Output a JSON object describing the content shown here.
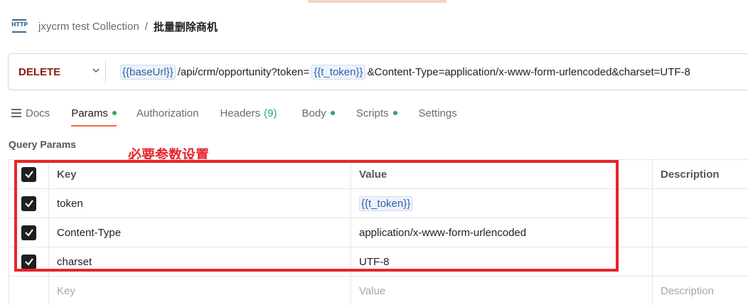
{
  "breadcrumb": {
    "icon": "http-request-icon",
    "parent": "jxycrm test Collection",
    "separator": "/",
    "current": "批量删除商机"
  },
  "request": {
    "method": "DELETE",
    "url_parts": {
      "base_var": "{{baseUrl}}",
      "path": "/api/crm/opportunity?token=",
      "token_var": "{{t_token}}",
      "query_tail": "&Content-Type=application/x-www-form-urlencoded&charset=UTF-8"
    }
  },
  "tabs": [
    {
      "label": "Docs",
      "icon": "docs-icon"
    },
    {
      "label": "Params",
      "active": true,
      "dot": true
    },
    {
      "label": "Authorization"
    },
    {
      "label": "Headers",
      "count": "(9)"
    },
    {
      "label": "Body",
      "dot": true
    },
    {
      "label": "Scripts",
      "dot": true
    },
    {
      "label": "Settings"
    }
  ],
  "query_params": {
    "title": "Query Params",
    "annotation": "必要参数设置",
    "columns": {
      "key": "Key",
      "value": "Value",
      "description": "Description"
    },
    "rows": [
      {
        "key": "token",
        "value": "{{t_token}}",
        "checked": true
      },
      {
        "key": "Content-Type",
        "value": "application/x-www-form-urlencoded",
        "checked": true
      },
      {
        "key": "charset",
        "value": "UTF-8",
        "checked": true
      }
    ],
    "empty_row": {
      "key": "Key",
      "value": "Value",
      "description": "Description"
    }
  },
  "colors": {
    "method": "#8e1a10",
    "active_tab_underline": "#f26b3a",
    "status_dot": "#22a86b",
    "annotation": "#e8242b",
    "variable": "#2f62a6"
  }
}
